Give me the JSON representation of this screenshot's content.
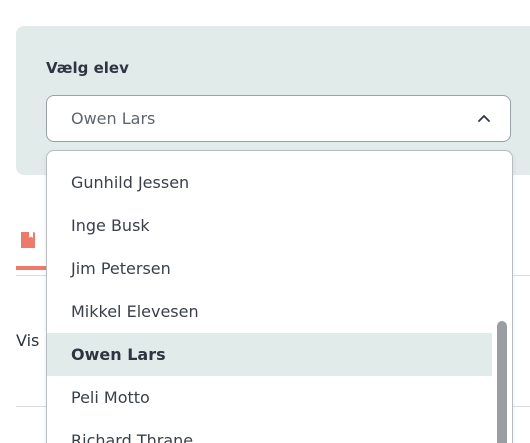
{
  "field": {
    "label": "Vælg elev",
    "value": "Owen Lars"
  },
  "background": {
    "partial_text": "Vis"
  },
  "dropdown": {
    "options": [
      {
        "label": "Gunhild Jessen",
        "selected": false
      },
      {
        "label": "Inge Busk",
        "selected": false
      },
      {
        "label": "Jim Petersen",
        "selected": false
      },
      {
        "label": "Mikkel Elevesen",
        "selected": false
      },
      {
        "label": "Owen Lars",
        "selected": true
      },
      {
        "label": "Peli Motto",
        "selected": false
      },
      {
        "label": "Richard Thrane",
        "selected": false
      }
    ]
  },
  "icons": {
    "select_toggle": "chevron-up-icon",
    "background_tab": "bookmark-icon"
  },
  "colors": {
    "panel_bg": "#e1ecea",
    "selected_bg": "#e1ecea",
    "accent": "#ee7a6b",
    "text": "#2f3540"
  }
}
